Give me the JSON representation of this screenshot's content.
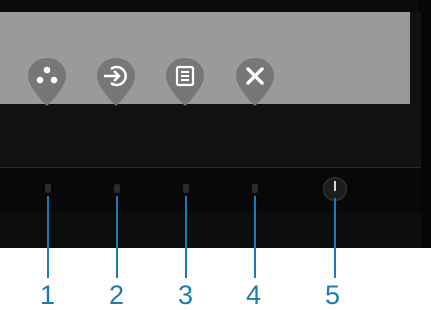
{
  "osd": {
    "keys": [
      {
        "name": "shortcut-key-icon",
        "color": "#7a7a7a"
      },
      {
        "name": "input-source-icon",
        "color": "#7a7a7a"
      },
      {
        "name": "menu-icon",
        "color": "#7a7a7a"
      },
      {
        "name": "close-icon",
        "color": "#7a7a7a"
      }
    ]
  },
  "buttons": {
    "labels": [
      "1",
      "2",
      "3",
      "4",
      "5"
    ],
    "label_color": "#1a7db0"
  }
}
